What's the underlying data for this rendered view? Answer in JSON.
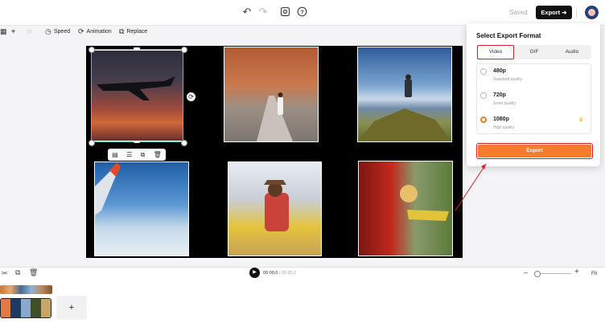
{
  "topbar": {
    "saved_label": "Saved",
    "export_label": "Export",
    "icons": [
      "undo-icon",
      "redo-icon",
      "screen-icon",
      "help-icon"
    ]
  },
  "tools": [
    {
      "label": "",
      "icon": "crop-icon"
    },
    {
      "label": "Speed",
      "icon": "speed-icon"
    },
    {
      "label": "Animation",
      "icon": "animation-icon"
    },
    {
      "label": "Replace",
      "icon": "replace-icon"
    }
  ],
  "timeline": {
    "current_time": "00:00.0",
    "separator": "/",
    "total_time": "00:05.0",
    "fit_label": "Fit",
    "add_label": "+"
  },
  "export_panel": {
    "title": "Select Export Format",
    "tabs": [
      "Video",
      "GIF",
      "Audio"
    ],
    "active_tab": "Video",
    "options": [
      {
        "res": "480p",
        "quality": "Standard quality",
        "selected": false
      },
      {
        "res": "720p",
        "quality": "Good quality",
        "selected": false
      },
      {
        "res": "1080p",
        "quality": "High quality",
        "selected": true
      }
    ],
    "export_button": "Export"
  },
  "colors": {
    "accent_orange": "#f47c2c",
    "highlight_red": "#d51f2a",
    "selection_teal": "#3ad1c4"
  }
}
